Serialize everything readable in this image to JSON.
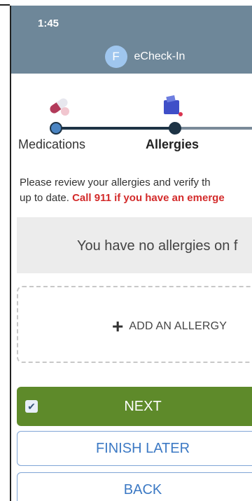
{
  "status_bar": {
    "time": "1:45"
  },
  "app": {
    "logo_letter": "F",
    "title": "eCheck-In"
  },
  "steps": [
    {
      "label": "Medications",
      "icon": "pill-icon",
      "state": "completed"
    },
    {
      "label": "Allergies",
      "icon": "gift-box-icon",
      "state": "active"
    }
  ],
  "instructions": {
    "line1": "Please review your allergies and verify th",
    "line2_prefix": "up to date. ",
    "line2_warning": "Call 911 if you have an emerge"
  },
  "empty_state": {
    "text": "You have no allergies on f"
  },
  "add_allergy": {
    "label": "ADD AN ALLERGY",
    "icon": "plus-icon"
  },
  "buttons": {
    "next": "NEXT",
    "finish_later": "FINISH LATER",
    "back": "BACK"
  },
  "colors": {
    "header": "#6e8799",
    "next_button": "#5e8a2a",
    "secondary_text": "#3c79c4",
    "warning": "#d32b2b"
  }
}
